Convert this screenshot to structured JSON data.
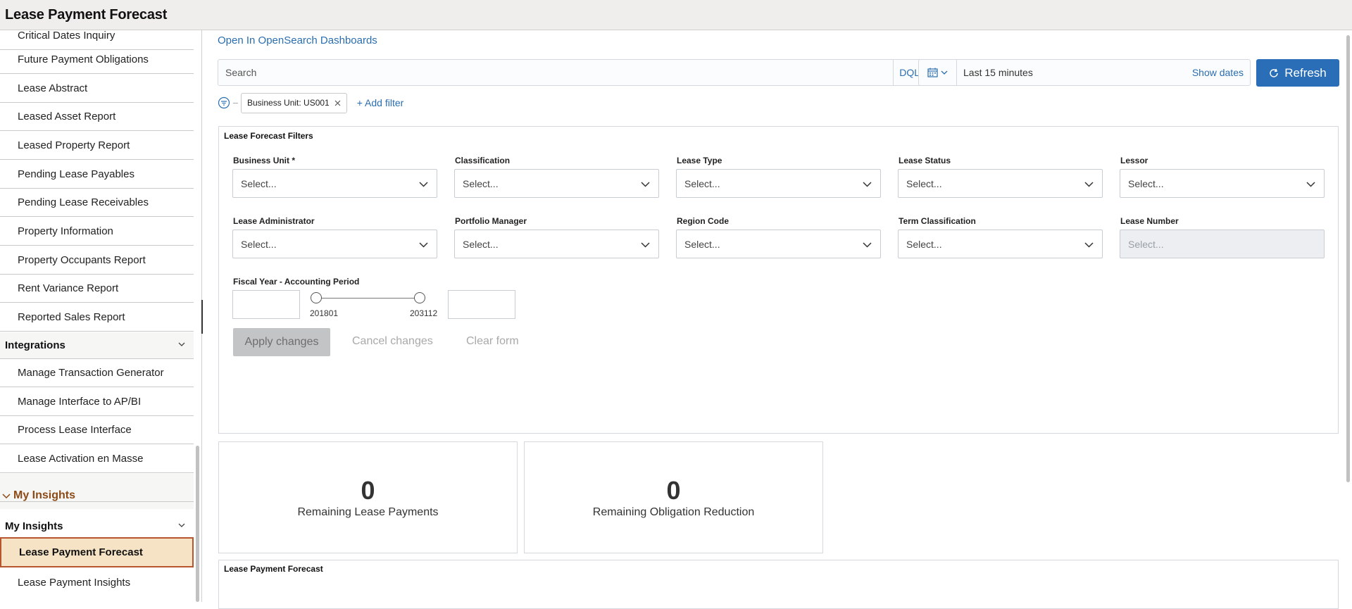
{
  "header": {
    "title": "Lease Payment Forecast"
  },
  "sidebar": {
    "items_top": [
      "Critical Dates Inquiry",
      "Future Payment Obligations",
      "Lease Abstract",
      "Leased Asset Report",
      "Leased Property Report",
      "Pending Lease Payables",
      "Pending Lease Receivables",
      "Property Information",
      "Property Occupants Report",
      "Rent Variance Report",
      "Reported Sales Report"
    ],
    "integrations": {
      "label": "Integrations",
      "items": [
        "Manage Transaction Generator",
        "Manage Interface to AP/BI",
        "Process Lease Interface",
        "Lease Activation en Masse"
      ]
    },
    "insights_group_label": "My Insights",
    "my_insights": {
      "label": "My Insights",
      "items": [
        "Lease Payment Forecast",
        "Lease Payment Insights"
      ],
      "selected": "Lease Payment Forecast"
    }
  },
  "toolbar": {
    "open_link": "Open In OpenSearch Dashboards",
    "search_placeholder": "Search",
    "dql_label": "DQL",
    "date_range": "Last 15 minutes",
    "show_dates": "Show dates",
    "refresh_label": "Refresh"
  },
  "filters": {
    "pill_label": "Business Unit: US001",
    "add_filter": "+ Add filter"
  },
  "filter_panel": {
    "title": "Lease Forecast Filters",
    "fields_row1": [
      {
        "label": "Business Unit *",
        "placeholder": "Select..."
      },
      {
        "label": "Classification",
        "placeholder": "Select..."
      },
      {
        "label": "Lease Type",
        "placeholder": "Select..."
      },
      {
        "label": "Lease Status",
        "placeholder": "Select..."
      },
      {
        "label": "Lessor",
        "placeholder": "Select..."
      }
    ],
    "fields_row2": [
      {
        "label": "Lease Administrator",
        "placeholder": "Select..."
      },
      {
        "label": "Portfolio Manager",
        "placeholder": "Select..."
      },
      {
        "label": "Region Code",
        "placeholder": "Select..."
      },
      {
        "label": "Term Classification",
        "placeholder": "Select..."
      },
      {
        "label": "Lease Number",
        "placeholder": "Select..."
      }
    ],
    "range_label": "Fiscal Year - Accounting Period",
    "range_min": "201801",
    "range_max": "203112",
    "apply": "Apply changes",
    "cancel": "Cancel changes",
    "clear": "Clear form"
  },
  "metrics": [
    {
      "value": "0",
      "label": "Remaining Lease Payments"
    },
    {
      "value": "0",
      "label": "Remaining Obligation Reduction"
    }
  ],
  "bottom_panel": {
    "title": "Lease Payment Forecast"
  },
  "colors": {
    "accent": "#2a6eb8",
    "link": "#2a6eb0",
    "selected_bg": "#f6e3c5",
    "selected_border": "#b5562e",
    "insights_group": "#8b4a16"
  }
}
